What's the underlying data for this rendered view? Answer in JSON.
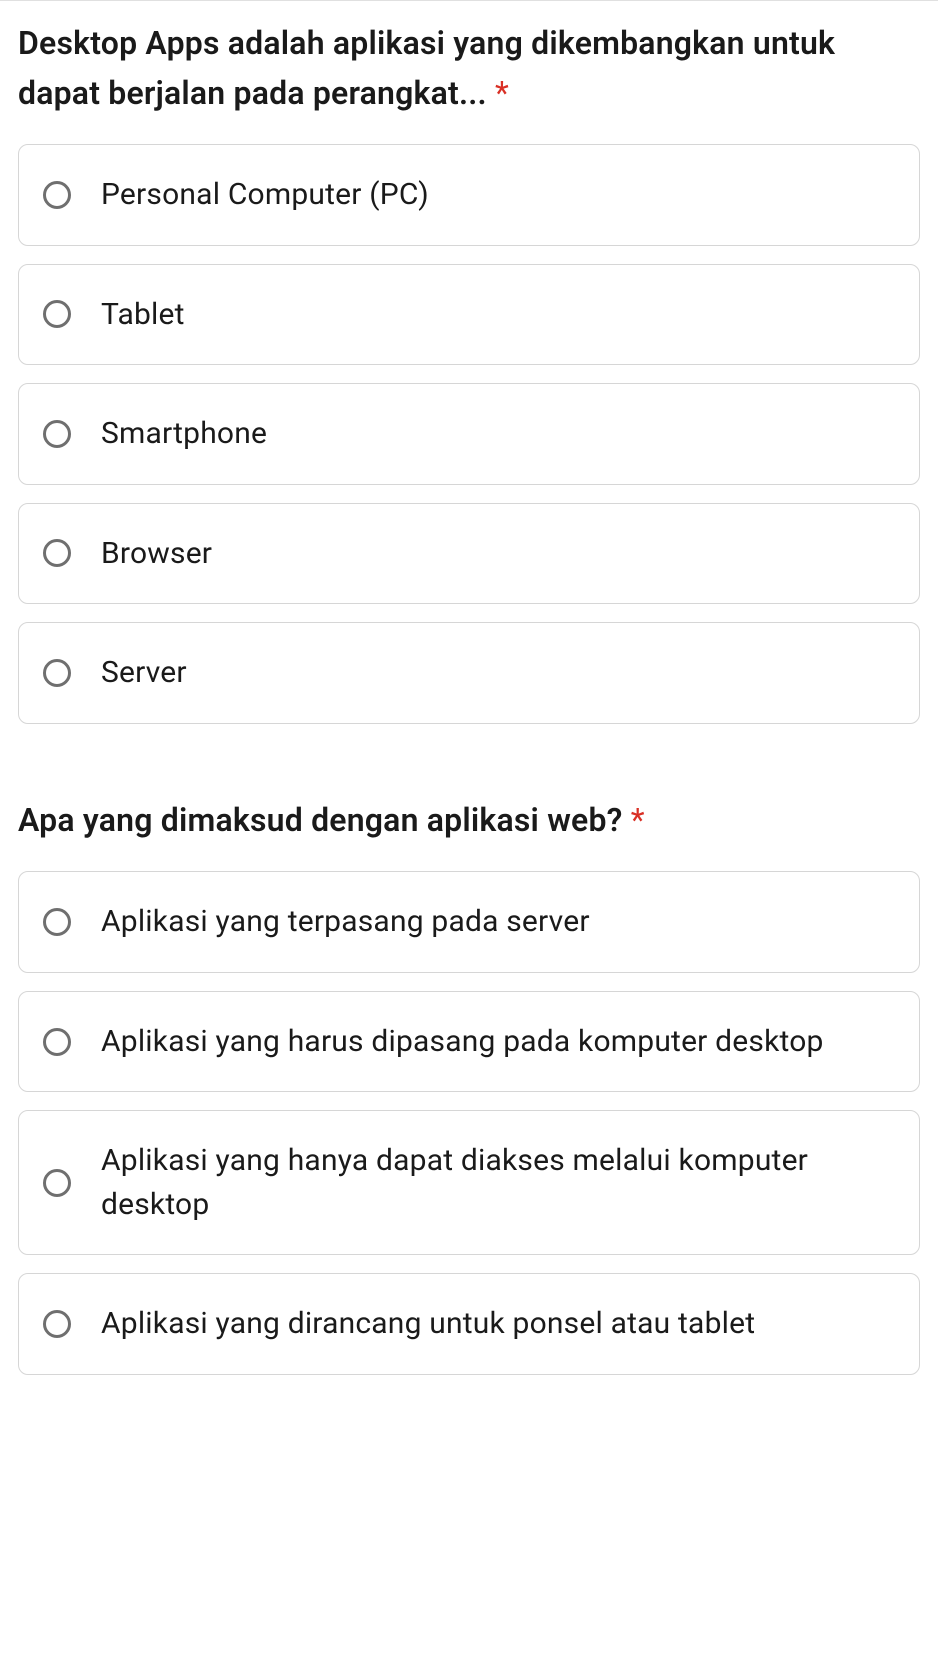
{
  "questions": [
    {
      "title": "Desktop Apps adalah aplikasi yang dikembangkan untuk dapat berjalan pada perangkat...",
      "required": true,
      "options": [
        "Personal Computer (PC)",
        "Tablet",
        "Smartphone",
        "Browser",
        "Server"
      ]
    },
    {
      "title": "Apa yang dimaksud dengan aplikasi web?",
      "required": true,
      "options": [
        "Aplikasi yang terpasang pada server",
        "Aplikasi yang harus dipasang pada komputer desktop",
        "Aplikasi yang hanya dapat diakses melalui komputer desktop",
        "Aplikasi yang dirancang untuk ponsel atau tablet"
      ]
    }
  ],
  "required_symbol": "*"
}
